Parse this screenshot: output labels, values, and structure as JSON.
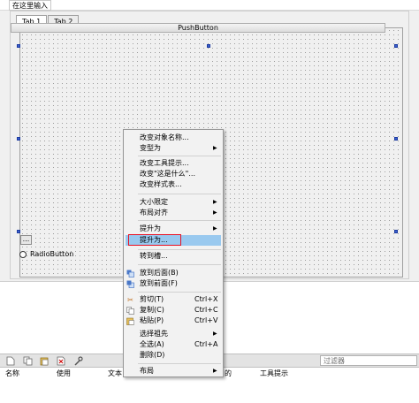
{
  "menubar": {
    "input_label": "在这里输入"
  },
  "form": {
    "tabs": [
      {
        "label": "Tab 1"
      },
      {
        "label": "Tab 2"
      }
    ],
    "pushbutton_label": "PushButton",
    "small_button_label": "...",
    "radio_label": "RadioButton"
  },
  "context_menu": {
    "items": [
      {
        "label": "改变对象名称..."
      },
      {
        "label": "变型为"
      },
      {
        "label": "改变工具提示..."
      },
      {
        "label": "改变\"这是什么\"..."
      },
      {
        "label": "改变样式表..."
      },
      {
        "label": "大小限定"
      },
      {
        "label": "布局对齐"
      },
      {
        "label": "提升为"
      },
      {
        "label": "提升为..."
      },
      {
        "label": "转到槽..."
      },
      {
        "label": "放到后面(B)"
      },
      {
        "label": "放到前面(F)"
      },
      {
        "label": "剪切(T)",
        "shortcut": "Ctrl+X"
      },
      {
        "label": "复制(C)",
        "shortcut": "Ctrl+C"
      },
      {
        "label": "粘贴(P)",
        "shortcut": "Ctrl+V"
      },
      {
        "label": "选择祖先"
      },
      {
        "label": "全选(A)",
        "shortcut": "Ctrl+A"
      },
      {
        "label": "删除(D)"
      },
      {
        "label": "布局"
      }
    ]
  },
  "dock": {
    "filter_placeholder": "过滤器",
    "columns": [
      "名称",
      "使用",
      "文本",
      "的",
      "工具提示"
    ]
  }
}
